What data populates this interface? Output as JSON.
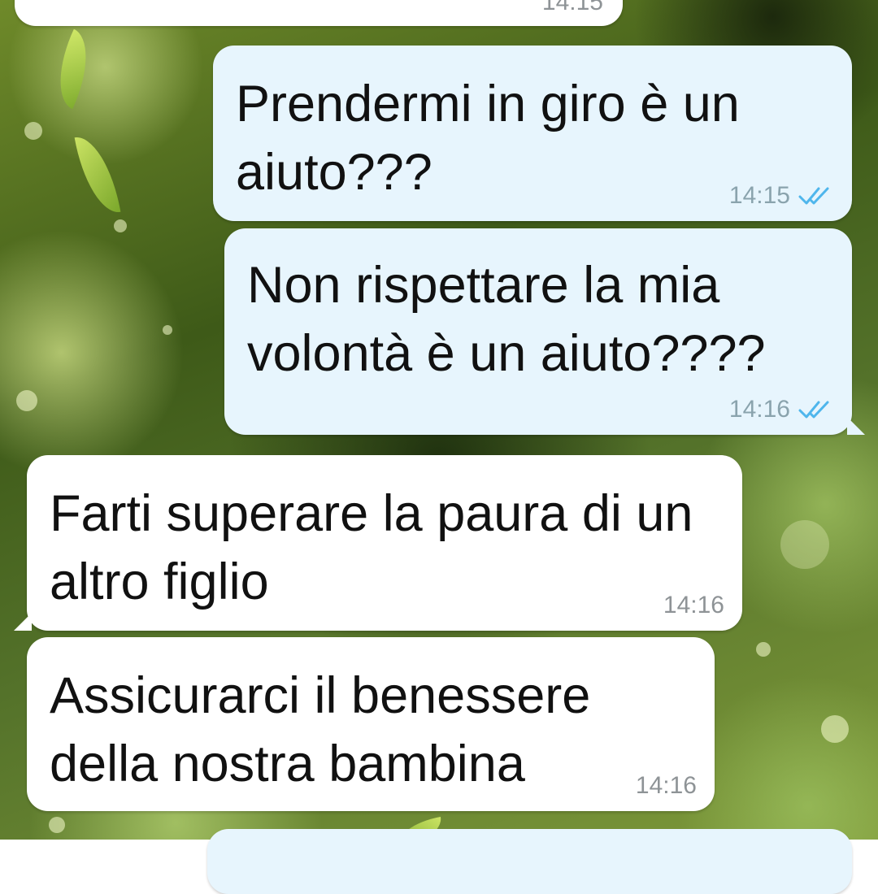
{
  "chat": {
    "partial_top_time": "14:15",
    "messages": [
      {
        "direction": "out",
        "text": "Prendermi in giro è un aiuto???",
        "time": "14:15",
        "status": "read"
      },
      {
        "direction": "out",
        "text": "Non rispettare la mia volontà è un aiuto????",
        "time": "14:16",
        "status": "read"
      },
      {
        "direction": "in",
        "text": "Farti superare la paura di un altro figlio",
        "time": "14:16"
      },
      {
        "direction": "in",
        "text": "Assicurarci il benessere della nostra bambina",
        "time": "14:16"
      }
    ]
  },
  "colors": {
    "outgoing_bubble": "#e7f5fd",
    "incoming_bubble": "#ffffff",
    "read_ticks": "#4fb6ec"
  },
  "icons": {
    "read_status": "double-check-icon"
  }
}
